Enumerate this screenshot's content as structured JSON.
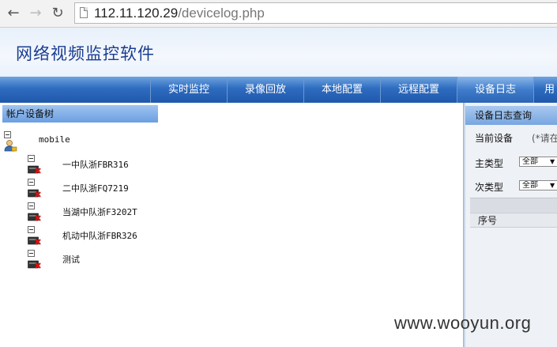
{
  "browser": {
    "url_host": "112.11.120.29",
    "url_path": "/devicelog.php"
  },
  "app": {
    "title": "网络视频监控软件"
  },
  "nav": {
    "tabs": [
      {
        "label": "实时监控"
      },
      {
        "label": "录像回放"
      },
      {
        "label": "本地配置"
      },
      {
        "label": "远程配置"
      },
      {
        "label": "设备日志",
        "active": true
      },
      {
        "label": "用"
      }
    ]
  },
  "tree": {
    "header": "帐户设备树",
    "root": "mobile",
    "devices": [
      "一中队浙FBR316",
      "二中队浙FQ7219",
      "当湖中队浙F3202T",
      "机动中队浙FBR326",
      "测试"
    ]
  },
  "query": {
    "header": "设备日志查询",
    "current_device_label": "当前设备",
    "current_device_hint": "(*请在",
    "main_type_label": "主类型",
    "main_type_value": "全部",
    "sub_type_label": "次类型",
    "sub_type_value": "全部",
    "col_index": "序号"
  },
  "watermark": "www.wooyun.org",
  "colors": {
    "nav_blue": "#2e6cc0",
    "title_blue": "#1a3d92"
  }
}
